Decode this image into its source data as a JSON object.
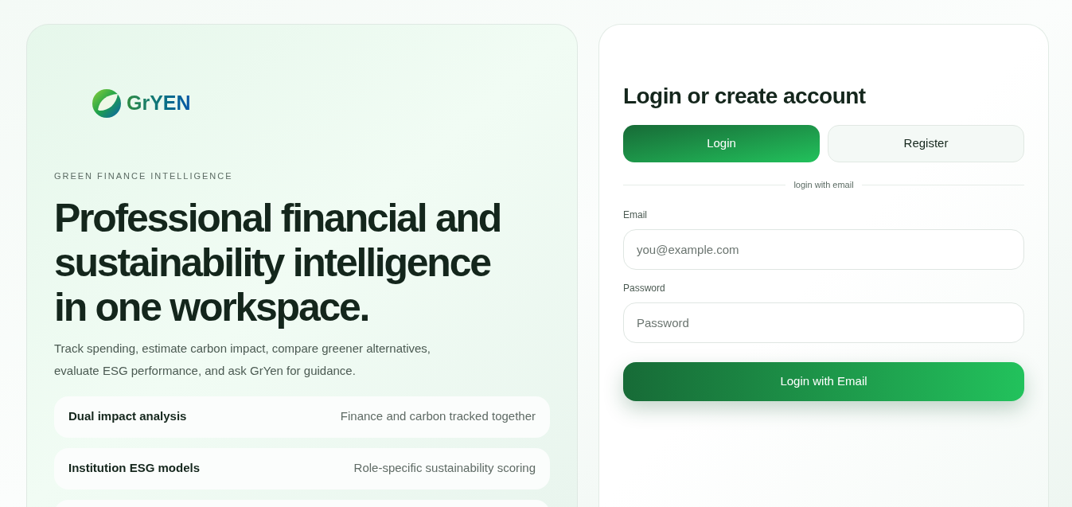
{
  "brand": {
    "logo_text": "GrYEN"
  },
  "hero": {
    "eyebrow": "GREEN FINANCE INTELLIGENCE",
    "headline": "Professional financial and sustainability intelligence in one workspace.",
    "description": "Track spending, estimate carbon impact, compare greener alternatives, evaluate ESG performance, and ask GrYen for guidance."
  },
  "features": [
    {
      "title": "Dual impact analysis",
      "detail": "Finance and carbon tracked together"
    },
    {
      "title": "Institution ESG models",
      "detail": "Role-specific sustainability scoring"
    }
  ],
  "auth": {
    "title": "Login or create account",
    "tabs": [
      {
        "label": "Login",
        "selected": true
      },
      {
        "label": "Register",
        "selected": false
      }
    ],
    "divider": "login with email",
    "fields": [
      {
        "label": "Email",
        "placeholder": "you@example.com"
      },
      {
        "label": "Password",
        "placeholder": "Password"
      }
    ],
    "submit": "Login with Email"
  }
}
